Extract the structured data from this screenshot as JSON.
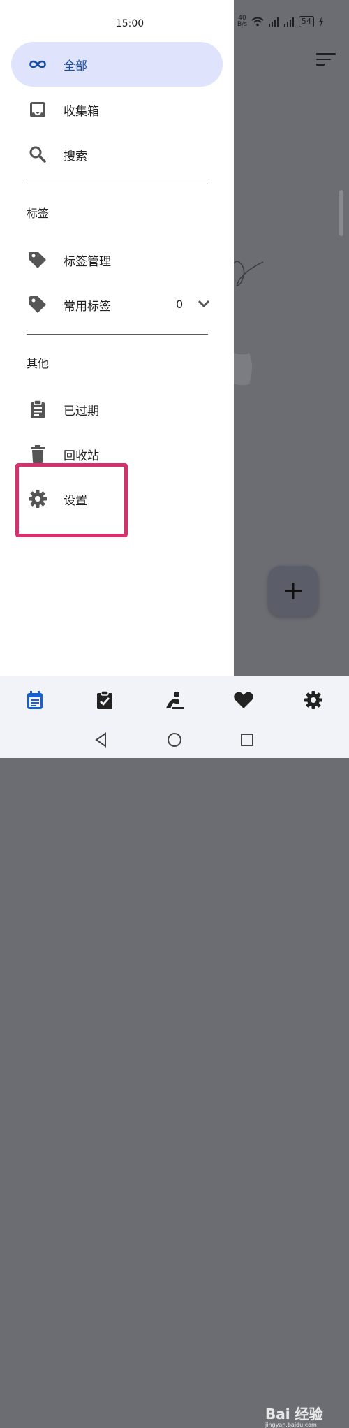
{
  "status_bar": {
    "time": "15:00",
    "net_speed_top": "40",
    "net_speed_bottom": "B/s",
    "battery": "54"
  },
  "drawer": {
    "primary_items": [
      {
        "label": "全部",
        "icon": "infinity-icon",
        "active": true
      },
      {
        "label": "收集箱",
        "icon": "inbox-icon"
      },
      {
        "label": "搜索",
        "icon": "search-icon"
      }
    ],
    "tags_section": {
      "heading": "标签",
      "items": [
        {
          "label": "标签管理",
          "icon": "tag-icon"
        },
        {
          "label": "常用标签",
          "icon": "tag-icon",
          "count": "0"
        }
      ]
    },
    "other_section": {
      "heading": "其他",
      "items": [
        {
          "label": "已过期",
          "icon": "clipboard-icon"
        },
        {
          "label": "回收站",
          "icon": "trash-icon"
        },
        {
          "label": "设置",
          "icon": "gear-icon"
        }
      ]
    }
  },
  "bottom_nav": {
    "tabs": [
      "calendar-icon",
      "task-check-icon",
      "meditation-icon",
      "heart-icon",
      "settings-icon"
    ]
  },
  "system_nav": [
    "back-icon",
    "home-icon",
    "recents-icon"
  ],
  "watermark": {
    "brand": "Bai 经验",
    "url": "jingyan.baidu.com"
  },
  "colors": {
    "accent": "#174ea6",
    "active_bg": "#dfe3fc",
    "highlight": "#d6306f",
    "scrim": "#6b6d73"
  }
}
